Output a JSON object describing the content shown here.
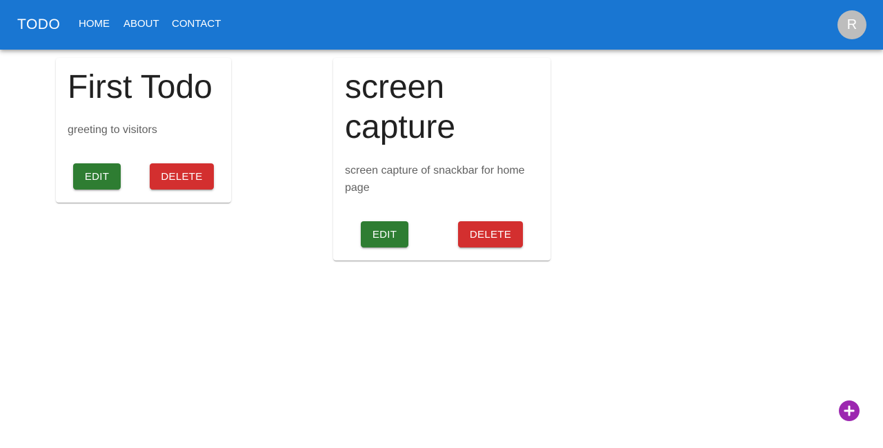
{
  "appbar": {
    "brand": "TODO",
    "nav": [
      {
        "label": "HOME"
      },
      {
        "label": "ABOUT"
      },
      {
        "label": "CONTACT"
      }
    ],
    "avatar_initial": "R",
    "color": "#1976d2"
  },
  "todos": [
    {
      "title": "First Todo",
      "description": "greeting to visitors",
      "edit_label": "EDIT",
      "delete_label": "DELETE"
    },
    {
      "title_lines": [
        "screen",
        "capture"
      ],
      "description_lines": [
        "screen capture of snackbar for home",
        "page"
      ],
      "edit_label": "EDIT",
      "delete_label": "DELETE"
    }
  ],
  "colors": {
    "edit": "#2e7d32",
    "delete": "#d32f2f",
    "fab": "#9c27b0",
    "avatar": "#bdbdbd"
  },
  "fab": {
    "icon": "add-icon"
  }
}
